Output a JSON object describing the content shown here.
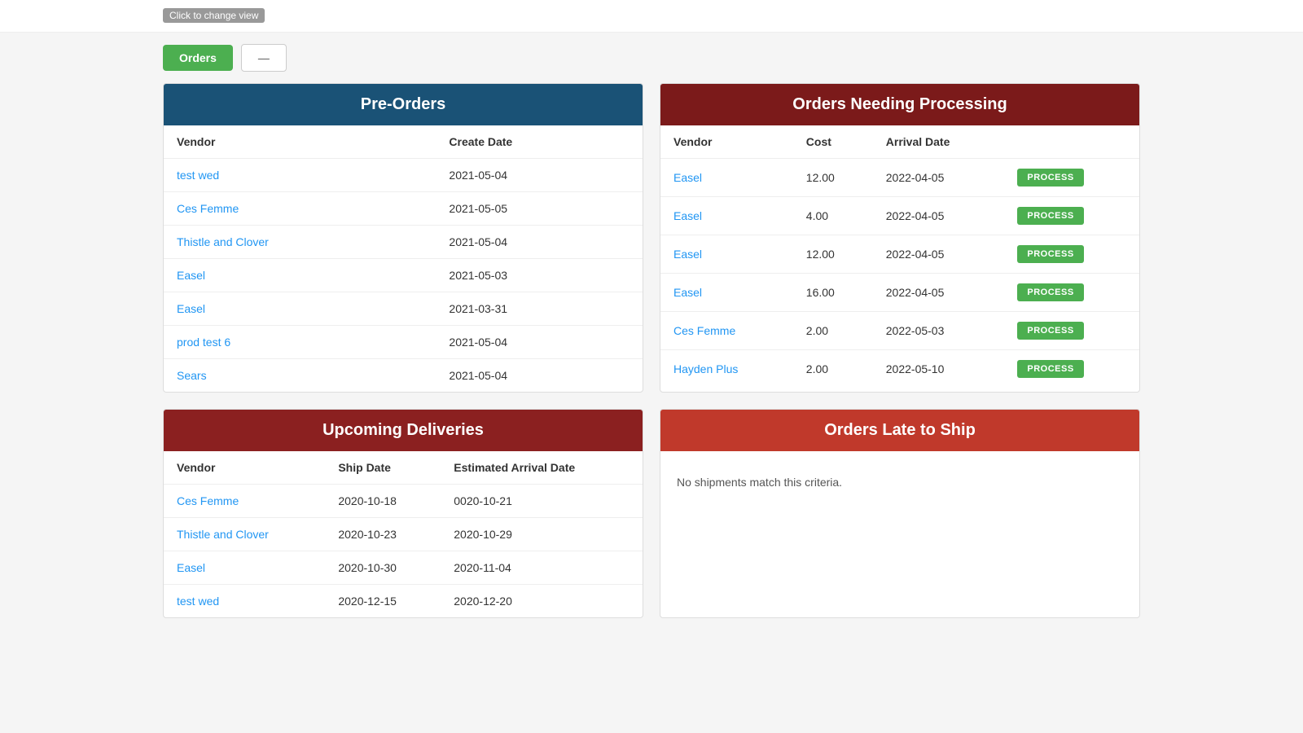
{
  "hint": {
    "label": "Click to change view"
  },
  "toolbar": {
    "orders_label": "Orders",
    "dash_label": "—"
  },
  "pre_orders": {
    "title": "Pre-Orders",
    "columns": [
      "Vendor",
      "Create Date"
    ],
    "rows": [
      {
        "vendor": "test wed",
        "create_date": "2021-05-04"
      },
      {
        "vendor": "Ces Femme",
        "create_date": "2021-05-05"
      },
      {
        "vendor": "Thistle and Clover",
        "create_date": "2021-05-04"
      },
      {
        "vendor": "Easel",
        "create_date": "2021-05-03"
      },
      {
        "vendor": "Easel",
        "create_date": "2021-03-31"
      },
      {
        "vendor": "prod test 6",
        "create_date": "2021-05-04"
      },
      {
        "vendor": "Sears",
        "create_date": "2021-05-04"
      }
    ]
  },
  "orders_needing_processing": {
    "title": "Orders Needing Processing",
    "columns": [
      "Vendor",
      "Cost",
      "Arrival Date"
    ],
    "process_label": "PROCESS",
    "rows": [
      {
        "vendor": "Easel",
        "cost": "12.00",
        "arrival_date": "2022-04-05"
      },
      {
        "vendor": "Easel",
        "cost": "4.00",
        "arrival_date": "2022-04-05"
      },
      {
        "vendor": "Easel",
        "cost": "12.00",
        "arrival_date": "2022-04-05"
      },
      {
        "vendor": "Easel",
        "cost": "16.00",
        "arrival_date": "2022-04-05"
      },
      {
        "vendor": "Ces Femme",
        "cost": "2.00",
        "arrival_date": "2022-05-03"
      },
      {
        "vendor": "Hayden Plus",
        "cost": "2.00",
        "arrival_date": "2022-05-10"
      }
    ]
  },
  "upcoming_deliveries": {
    "title": "Upcoming Deliveries",
    "columns": [
      "Vendor",
      "Ship Date",
      "Estimated Arrival Date"
    ],
    "rows": [
      {
        "vendor": "Ces Femme",
        "ship_date": "2020-10-18",
        "arrival_date": "0020-10-21"
      },
      {
        "vendor": "Thistle and Clover",
        "ship_date": "2020-10-23",
        "arrival_date": "2020-10-29"
      },
      {
        "vendor": "Easel",
        "ship_date": "2020-10-30",
        "arrival_date": "2020-11-04"
      },
      {
        "vendor": "test wed",
        "ship_date": "2020-12-15",
        "arrival_date": "2020-12-20"
      }
    ]
  },
  "orders_late": {
    "title": "Orders Late to Ship",
    "no_match": "No shipments match this criteria."
  }
}
